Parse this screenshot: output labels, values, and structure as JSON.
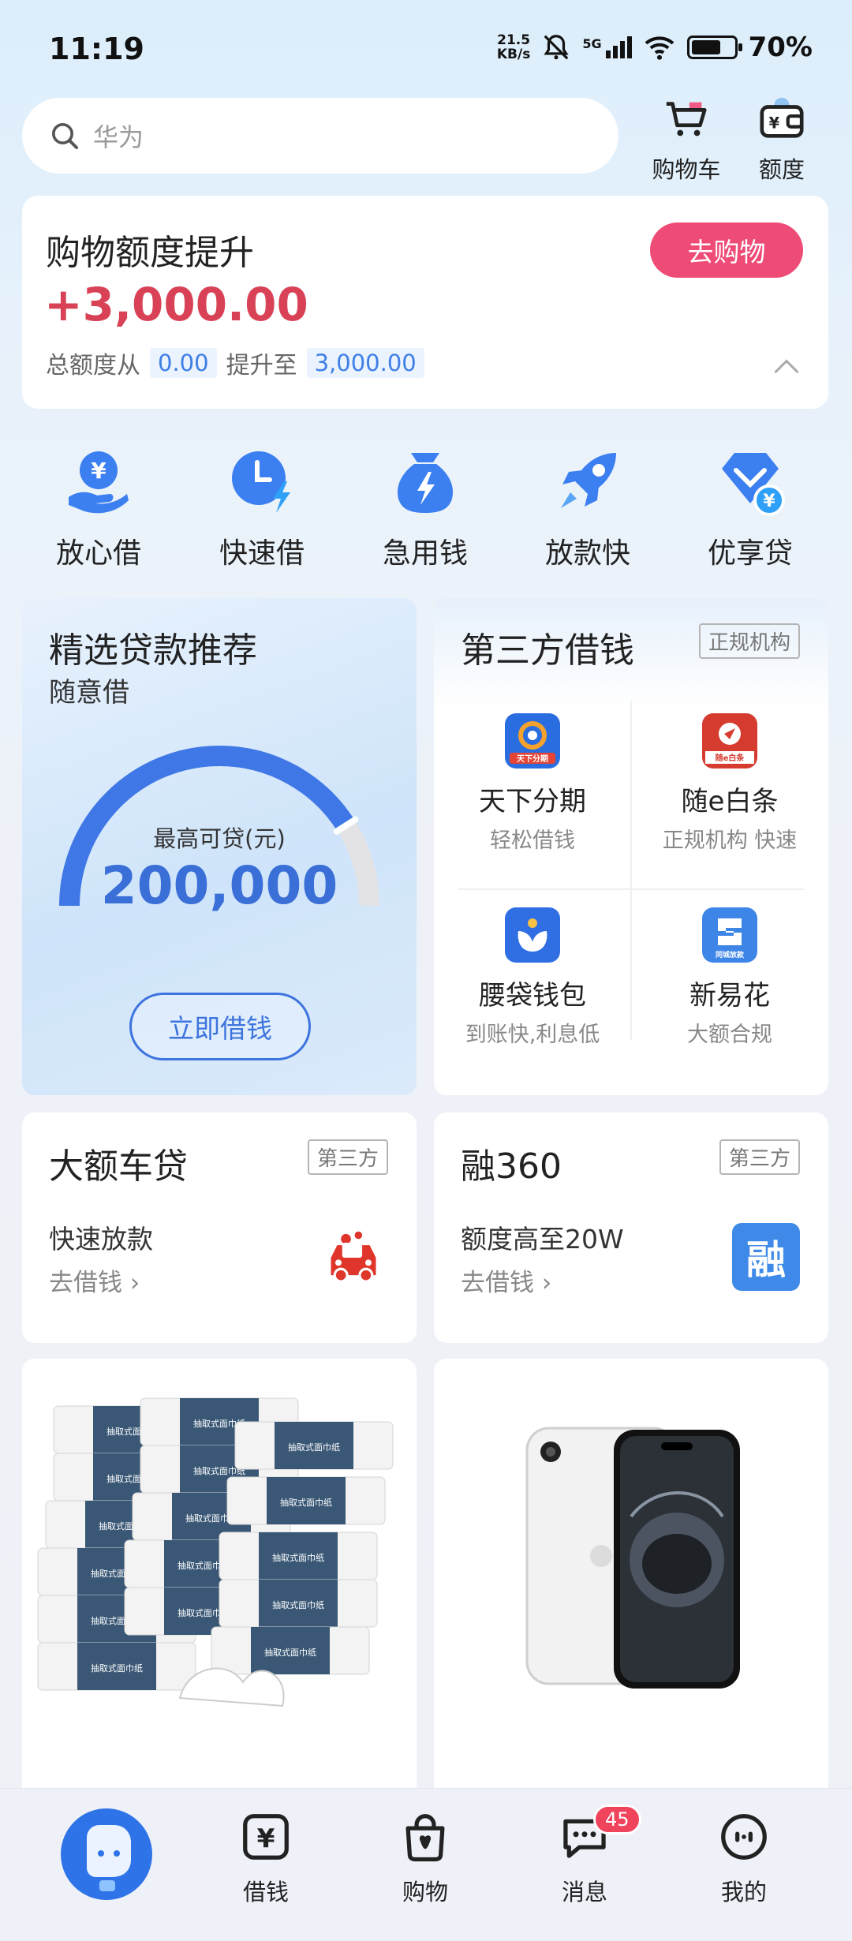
{
  "status_bar": {
    "time": "11:19",
    "net_speed_value": "21.5",
    "net_speed_unit": "KB/s",
    "network": "5G",
    "battery": "70%",
    "battery_level": 0.7
  },
  "search": {
    "placeholder": "华为"
  },
  "top_actions": {
    "cart_label": "购物车",
    "quota_label": "额度"
  },
  "credit_card": {
    "title": "购物额度提升",
    "amount": "+3,000.00",
    "from_label": "总额度从",
    "from_value": "0.00",
    "to_label": "提升至",
    "to_value": "3,000.00",
    "button_label": "去购物"
  },
  "quick_loans": [
    {
      "label": "放心借",
      "icon": "hand-yuan-icon"
    },
    {
      "label": "快速借",
      "icon": "clock-bolt-icon"
    },
    {
      "label": "急用钱",
      "icon": "money-bag-bolt-icon"
    },
    {
      "label": "放款快",
      "icon": "rocket-icon"
    },
    {
      "label": "优享贷",
      "icon": "diamond-yuan-icon"
    }
  ],
  "featured": {
    "title": "精选贷款推荐",
    "subtitle": "随意借",
    "gauge_label": "最高可贷(元)",
    "gauge_value": "200,000",
    "gauge_fill": 0.82,
    "button_label": "立即借钱"
  },
  "third_party": {
    "title": "第三方借钱",
    "tag": "正规机构",
    "partners": [
      {
        "name": "天下分期",
        "desc": "轻松借钱",
        "logo_text": "天下分期",
        "color": "#2a6de0"
      },
      {
        "name": "随e白条",
        "desc": "正规机构 快速",
        "logo_text": "随e白条",
        "color": "#d63b2f"
      },
      {
        "name": "腰袋钱包",
        "desc": "到账快,利息低",
        "logo_text": "",
        "color": "#2f6fe3"
      },
      {
        "name": "新易花",
        "desc": "大额合规",
        "logo_text": "同城放款",
        "color": "#3d86e8"
      }
    ]
  },
  "promos": [
    {
      "title": "大额车贷",
      "tag": "第三方",
      "line1": "快速放款",
      "line2": "去借钱 ›",
      "icon": "car-loan-icon"
    },
    {
      "title": "融360",
      "tag": "第三方",
      "line1": "额度高至20W",
      "line2": "去借钱 ›",
      "icon": "rong360-logo-icon",
      "icon_text": "融"
    }
  ],
  "products": [
    {
      "name": "tissue-pack-product",
      "icon": "tissue-pack-icon",
      "package_text": "抽取式面巾纸"
    },
    {
      "name": "phone-product",
      "icon": "smartphone-icon"
    }
  ],
  "bottom_nav": [
    {
      "label": "",
      "icon": "assistant-avatar-icon"
    },
    {
      "label": "借钱",
      "icon": "yuan-icon"
    },
    {
      "label": "购物",
      "icon": "shopping-bag-icon"
    },
    {
      "label": "消息",
      "icon": "chat-icon",
      "badge": "45"
    },
    {
      "label": "我的",
      "icon": "profile-icon"
    }
  ],
  "colors": {
    "accent_blue": "#3d74de",
    "accent_red": "#d94256",
    "shop_button": "#ee4b77"
  }
}
